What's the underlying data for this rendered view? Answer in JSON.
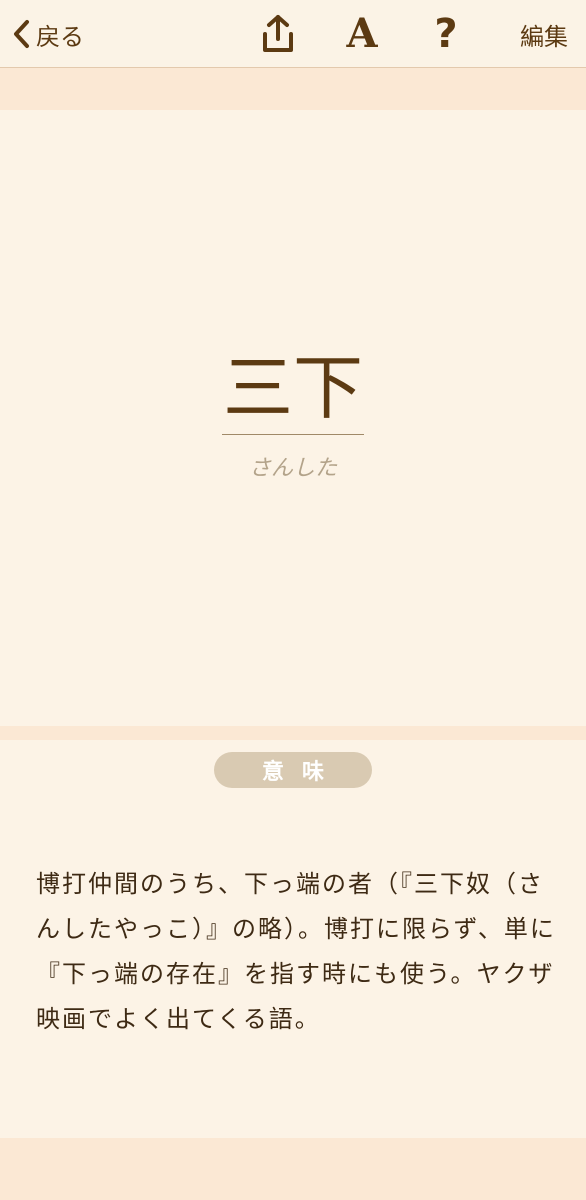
{
  "nav": {
    "back_label": "戻る",
    "font_label": "A",
    "help_label": "?",
    "edit_label": "編集"
  },
  "entry": {
    "word": "三下",
    "reading": "さんした",
    "section_label": "意味",
    "meaning": "博打仲間のうち、下っ端の者（『三下奴（さんしたやっこ）』の略）。博打に限らず、単に『下っ端の存在』を指す時にも使う。ヤクザ映画でよく出てくる語。"
  },
  "icons": {
    "back": "chevron-left-icon",
    "share": "share-icon",
    "font": "font-size-icon",
    "help": "help-icon"
  },
  "colors": {
    "accent": "#5c3a12",
    "background": "#fcf3e6",
    "strip": "#fbe8d4",
    "pill": "#d9cab2",
    "reading": "#b3a38a"
  }
}
